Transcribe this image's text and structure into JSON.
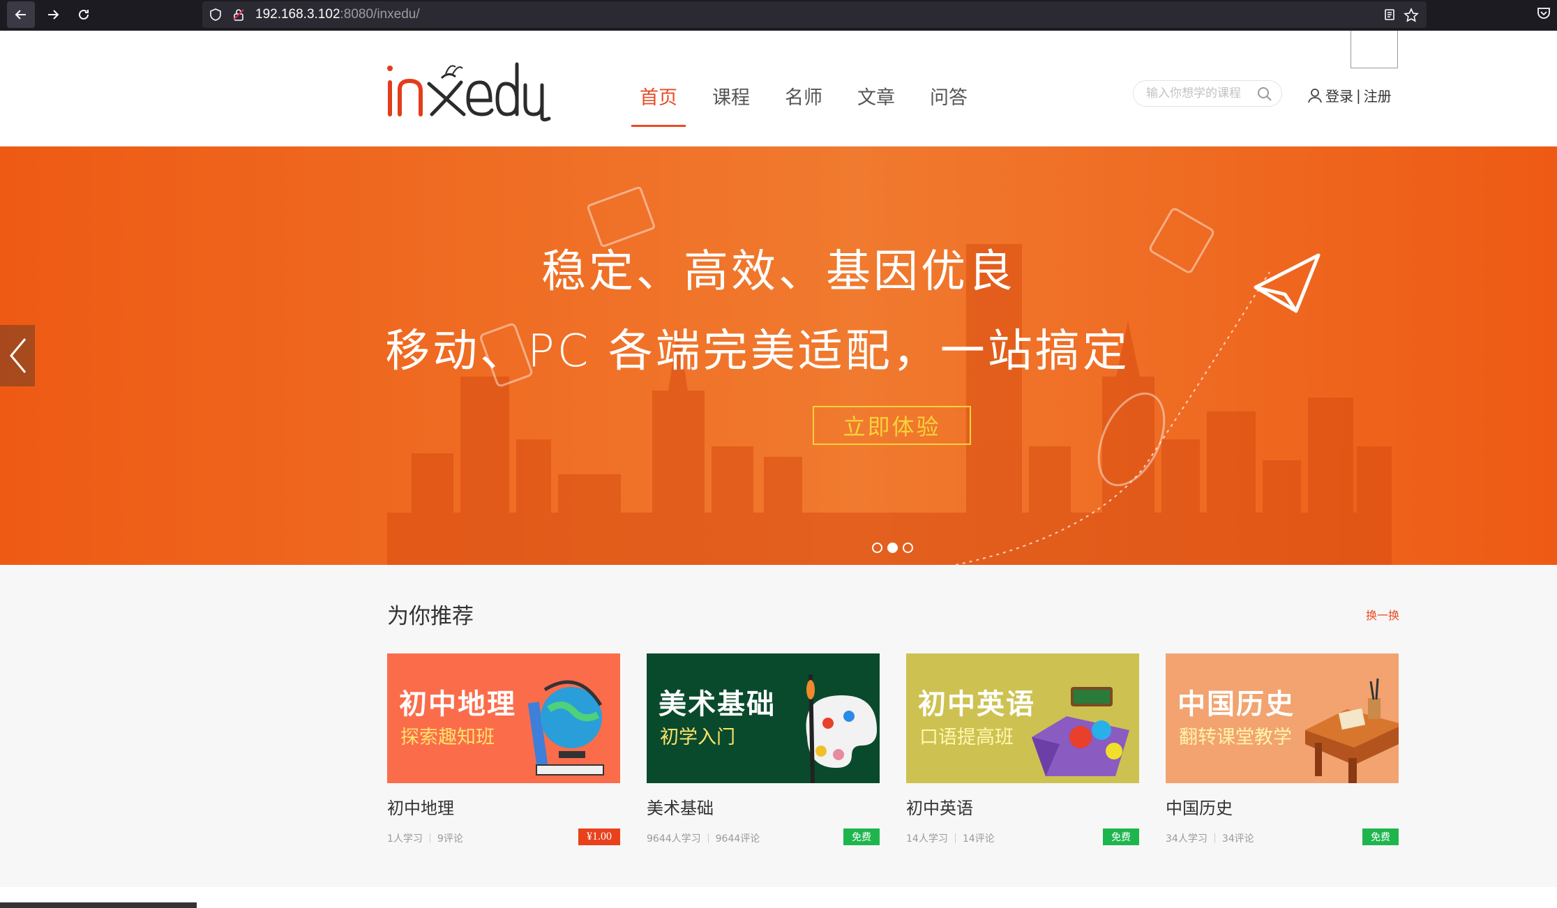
{
  "browser": {
    "url_host": "192.168.3.102",
    "url_rest": ":8080/inxedu/"
  },
  "header": {
    "logo_text": "inxedu",
    "nav": [
      {
        "label": "首页",
        "active": true
      },
      {
        "label": "课程",
        "active": false
      },
      {
        "label": "名师",
        "active": false
      },
      {
        "label": "文章",
        "active": false
      },
      {
        "label": "问答",
        "active": false
      }
    ],
    "search_placeholder": "输入你想学的课程",
    "login": "登录",
    "separator": "|",
    "register": "注册"
  },
  "banner": {
    "line1": "稳定、高效、基因优良",
    "line2": "移动、PC 各端完美适配，一站搞定",
    "cta": "立即体验",
    "background": "#ee5a14",
    "cta_color": "#f7d23b",
    "slides": 3,
    "active_slide": 2
  },
  "recommend": {
    "title": "为你推荐",
    "refresh": "换一换",
    "courses": [
      {
        "cover_title": "初中地理",
        "cover_sub": "探索趣知班",
        "cover_bg": "#fb6c4b",
        "cover_sub_color": "#ffe36b",
        "name": "初中地理",
        "students": "1人学习",
        "comments": "9评论",
        "price": "¥1.00",
        "free": false
      },
      {
        "cover_title": "美术基础",
        "cover_sub": "初学入门",
        "cover_bg": "#0a4a2c",
        "cover_sub_color": "#ffe36b",
        "name": "美术基础",
        "students": "9644人学习",
        "comments": "9644评论",
        "price": "免费",
        "free": true
      },
      {
        "cover_title": "初中英语",
        "cover_sub": "口语提高班",
        "cover_bg": "#cdc251",
        "cover_sub_color": "#fff7b0",
        "name": "初中英语",
        "students": "14人学习",
        "comments": "14评论",
        "price": "免费",
        "free": true
      },
      {
        "cover_title": "中国历史",
        "cover_sub": "翻转课堂教学",
        "cover_bg": "#f2a370",
        "cover_sub_color": "#fff4a8",
        "name": "中国历史",
        "students": "34人学习",
        "comments": "34评论",
        "price": "免费",
        "free": true
      }
    ]
  },
  "icons": [
    "back-arrow-icon",
    "forward-arrow-icon",
    "reload-icon",
    "shield-icon",
    "lock-icon",
    "reader-icon",
    "star-icon",
    "pocket-icon",
    "search-icon",
    "user-icon",
    "chevron-left-icon",
    "paper-plane-icon"
  ]
}
